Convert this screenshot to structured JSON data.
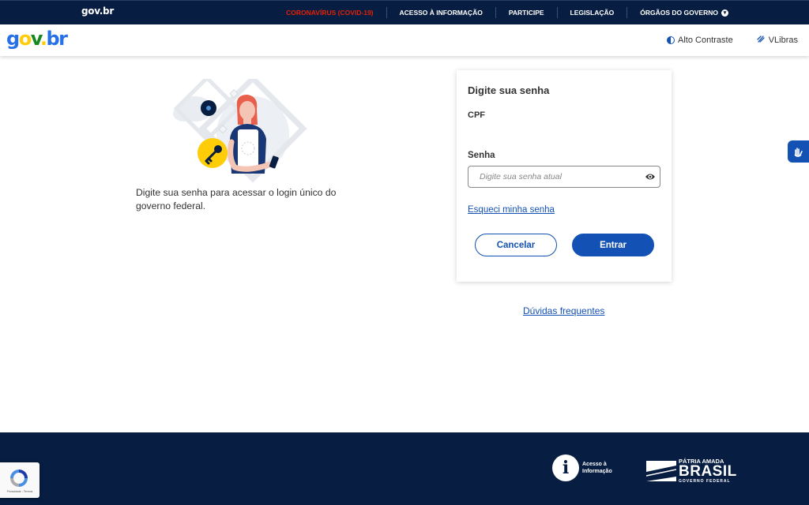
{
  "topbar": {
    "brand": "gov.br",
    "nav": [
      {
        "label": "CORONAVÍRUS (COVID-19)"
      },
      {
        "label": "ACESSO À INFORMAÇÃO"
      },
      {
        "label": "PARTICIPE"
      },
      {
        "label": "LEGISLAÇÃO"
      },
      {
        "label": "ÓRGÃOS DO GOVERNO"
      }
    ],
    "nav_caret_icon": "chevron-down-icon",
    "covid_color": "#e52207",
    "background": "#071d41"
  },
  "header": {
    "logo": {
      "g": "g",
      "o": "o",
      "v": "v",
      "dot": ".",
      "br": "br"
    },
    "alto_contraste": "Alto Contraste",
    "vlibras": "VLibras"
  },
  "intro": {
    "text": "Digite sua senha para acessar o login único do governo federal."
  },
  "card": {
    "title": "Digite sua senha",
    "cpf_label": "CPF",
    "senha_label": "Senha",
    "senha_placeholder": "Digite sua senha atual",
    "forgot_link": "Esqueci minha senha",
    "cancel_button": "Cancelar",
    "enter_button": "Entrar"
  },
  "faq_link": "Dúvidas frequentes",
  "footer": {
    "acesso_line1": "Acesso à",
    "acesso_line2": "Informação",
    "patria_line1": "PÁTRIA AMADA",
    "patria_line2": "BRASIL",
    "patria_line3": "GOVERNO FEDERAL"
  },
  "recaptcha": {
    "footer_text": "Privacidade - Termos"
  },
  "colors": {
    "primary": "#1351b4",
    "navy": "#071d41",
    "text": "#333333"
  }
}
